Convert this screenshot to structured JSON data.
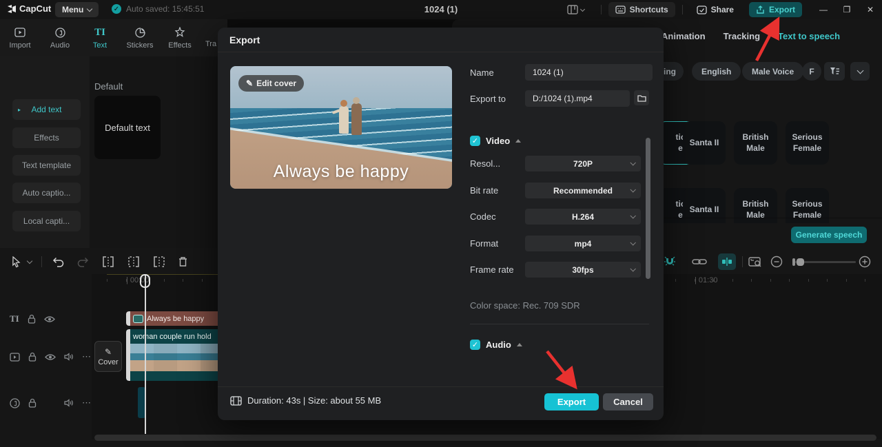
{
  "titlebar": {
    "logo": "CapCut",
    "menu": "Menu",
    "autosaved": "Auto saved: 15:45:51",
    "doc_title": "1024 (1)",
    "shortcuts": "Shortcuts",
    "share": "Share",
    "export": "Export",
    "window": {
      "min": "—",
      "max": "❐",
      "close": "✕"
    }
  },
  "left_panel": {
    "tabs": [
      {
        "label": "Import"
      },
      {
        "label": "Audio"
      },
      {
        "label": "Text"
      },
      {
        "label": "Stickers"
      },
      {
        "label": "Effects"
      },
      {
        "label": "Tra"
      }
    ],
    "sidebar": [
      {
        "label": "Add text"
      },
      {
        "label": "Effects"
      },
      {
        "label": "Text template"
      },
      {
        "label": "Auto captio..."
      },
      {
        "label": "Local capti..."
      }
    ],
    "section_title": "Default",
    "default_card": "Default text"
  },
  "right_panel": {
    "tabs": [
      "Animation",
      "Tracking",
      "Text to speech"
    ],
    "chips": {
      "partial_left": "ing",
      "language": "English",
      "voice": "Male Voice",
      "partial_right": "F"
    },
    "partial_card": {
      "line1": "tic",
      "line2": "e"
    },
    "cards_row1": [
      "Santa II",
      "British Male",
      "Serious Female"
    ],
    "cards_row2": [
      "Santa II",
      "British Male",
      "Serious Female"
    ],
    "generate_button": "Generate speech"
  },
  "dialog": {
    "title": "Export",
    "edit_cover": "Edit cover",
    "preview_caption": "Always be happy",
    "name_label": "Name",
    "name_value": "1024 (1)",
    "export_to_label": "Export to",
    "export_to_value": "D:/1024 (1).mp4",
    "video_section": "Video",
    "fields": [
      {
        "label": "Resol...",
        "value": "720P"
      },
      {
        "label": "Bit rate",
        "value": "Recommended"
      },
      {
        "label": "Codec",
        "value": "H.264"
      },
      {
        "label": "Format",
        "value": "mp4"
      },
      {
        "label": "Frame rate",
        "value": "30fps"
      }
    ],
    "color_space": "Color space: Rec. 709 SDR",
    "audio_section": "Audio",
    "footer_info": "Duration: 43s | Size: about 55 MB",
    "export_button": "Export",
    "cancel_button": "Cancel"
  },
  "timeline": {
    "ruler_start": "| 00:00",
    "ruler_mid": "| 01:30",
    "cover_button": "Cover",
    "text_clip_label": "Always be happy",
    "video_clip_label": "woman couple run hold"
  },
  "colors": {
    "accent": "#3fc6c8",
    "export_dialog_button": "#16c2d4",
    "arrow_red": "#e8312f"
  }
}
